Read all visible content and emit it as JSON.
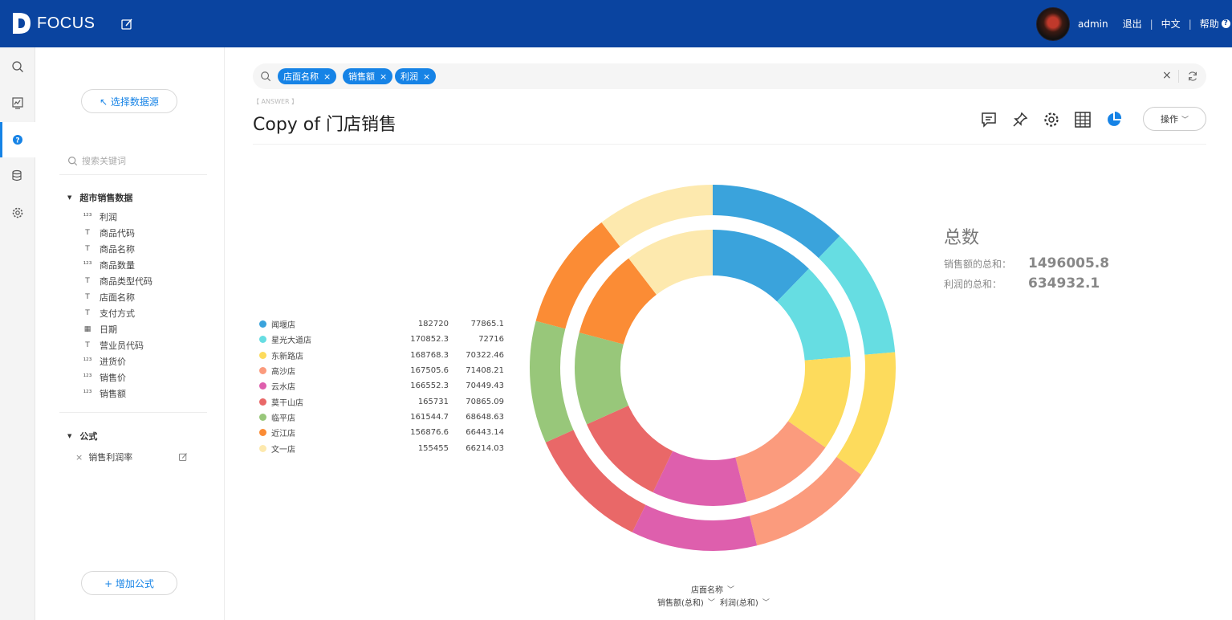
{
  "header": {
    "logo_text": "FOCUS",
    "user": "admin",
    "logout": "退出",
    "language": "中文",
    "help": "帮助"
  },
  "rail": [
    "search-icon",
    "dashboard-icon",
    "question-icon",
    "database-icon",
    "settings-icon"
  ],
  "sidebar": {
    "select_source": "↖ 选择数据源",
    "search_placeholder": "搜索关键词",
    "group_title": "超市销售数据",
    "fields": [
      {
        "type": "123",
        "name": "利润"
      },
      {
        "type": "T",
        "name": "商品代码"
      },
      {
        "type": "T",
        "name": "商品名称"
      },
      {
        "type": "123",
        "name": "商品数量"
      },
      {
        "type": "T",
        "name": "商品类型代码"
      },
      {
        "type": "T",
        "name": "店面名称"
      },
      {
        "type": "T",
        "name": "支付方式"
      },
      {
        "type": "date",
        "name": "日期"
      },
      {
        "type": "T",
        "name": "营业员代码"
      },
      {
        "type": "123",
        "name": "进货价"
      },
      {
        "type": "123",
        "name": "销售价"
      },
      {
        "type": "123",
        "name": "销售额"
      }
    ],
    "formula_title": "公式",
    "formula_item": "销售利润率",
    "add_formula": "+ 增加公式"
  },
  "search": {
    "tags": [
      "店面名称",
      "销售额",
      "利润"
    ]
  },
  "answer_label": "【 ANSWER 】",
  "title": "Copy of 门店销售",
  "operations": "操作",
  "totals": {
    "title": "总数",
    "rows": [
      {
        "label": "销售额的总和：",
        "value": "1496005.8"
      },
      {
        "label": "利润的总和：",
        "value": "634932.1"
      }
    ]
  },
  "axis": {
    "category": "店面名称",
    "measure1": "销售额(总和)",
    "measure2": "利润(总和)"
  },
  "chart_data": {
    "type": "pie",
    "categories": [
      "闻堰店",
      "星光大道店",
      "东新路店",
      "高沙店",
      "云水店",
      "莫干山店",
      "临平店",
      "近江店",
      "文一店"
    ],
    "colors": [
      "#3aa3dc",
      "#66dde2",
      "#fddb5c",
      "#fb9b7d",
      "#de5fad",
      "#e96868",
      "#98c77a",
      "#fb8c35",
      "#fde9ae"
    ],
    "series": [
      {
        "name": "销售额(总和)",
        "values": [
          182720,
          170852.3,
          168768.3,
          167505.6,
          166552.3,
          165731,
          161544.7,
          156876.6,
          155455
        ]
      },
      {
        "name": "利润(总和)",
        "values": [
          77865.1,
          72716,
          70322.46,
          71408.21,
          70449.43,
          70865.09,
          68648.63,
          66443.14,
          66214.03
        ]
      }
    ]
  }
}
